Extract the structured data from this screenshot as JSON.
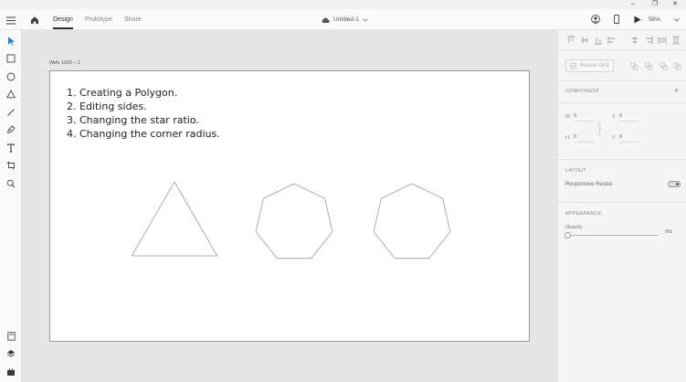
{
  "window": {
    "minimize": "‒",
    "restore": "❐",
    "close": "✕"
  },
  "appbar": {
    "tabs": [
      {
        "label": "Design",
        "active": true
      },
      {
        "label": "Prototype",
        "active": false
      },
      {
        "label": "Share",
        "active": false
      }
    ],
    "document_name": "Untitled-1",
    "zoom": "56%"
  },
  "tools": [
    "select-icon",
    "rectangle-icon",
    "ellipse-icon",
    "polygon-icon",
    "line-icon",
    "pen-icon",
    "text-icon",
    "artboard-icon",
    "zoom-icon"
  ],
  "bottom_tools": [
    "assets-icon",
    "layers-icon",
    "plugins-icon"
  ],
  "artboard": {
    "name": "Web 1920 – 1",
    "steps": [
      "1. Creating a Polygon.",
      "2. Editing sides.",
      "3. Changing the star ratio.",
      "4. Changing the corner radius."
    ],
    "shapes": [
      {
        "name": "triangle",
        "sides": 3
      },
      {
        "name": "heptagon",
        "sides": 7
      },
      {
        "name": "heptagon",
        "sides": 7
      }
    ]
  },
  "inspector": {
    "repeat_grid": "Repeat Grid",
    "component_title": "COMPONENT",
    "w_label": "W",
    "w_value": "0",
    "x_label": "X",
    "x_value": "0",
    "h_label": "H",
    "h_value": "0",
    "y_label": "Y",
    "y_value": "0",
    "layout_title": "LAYOUT",
    "responsive_resize": "Responsive Resize",
    "appearance_title": "APPEARANCE",
    "opacity_label": "Opacity",
    "opacity_value": "0%"
  }
}
